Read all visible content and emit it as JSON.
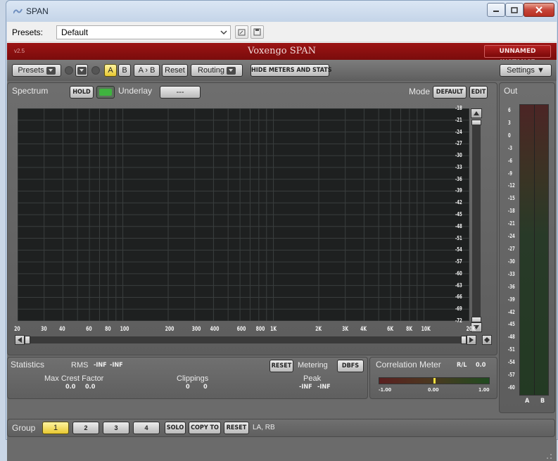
{
  "window": {
    "title": "SPAN"
  },
  "presetbar": {
    "label": "Presets:",
    "value": "Default"
  },
  "header": {
    "version": "v2.5",
    "title": "Voxengo SPAN",
    "instance": "UNNAMED INSTANCE"
  },
  "toolbar": {
    "presets": "Presets",
    "a": "A",
    "b": "B",
    "ab": "A › B",
    "reset": "Reset",
    "routing": "Routing",
    "hide_meters": "HIDE METERS AND STATS",
    "settings": "Settings ▼"
  },
  "spectrum": {
    "label": "Spectrum",
    "hold": "HOLD",
    "underlay_label": "Underlay",
    "underlay_value": "---",
    "mode_label": "Mode",
    "mode_value": "DEFAULT",
    "edit": "EDIT",
    "db_ticks": [
      "-18",
      "-21",
      "-24",
      "-27",
      "-30",
      "-33",
      "-36",
      "-39",
      "-42",
      "-45",
      "-48",
      "-51",
      "-54",
      "-57",
      "-60",
      "-63",
      "-66",
      "-69",
      "-72"
    ],
    "freq_ticks": [
      "20",
      "30",
      "40",
      "60",
      "80",
      "100",
      "200",
      "300",
      "400",
      "600",
      "800",
      "1K",
      "2K",
      "3K",
      "4K",
      "6K",
      "8K",
      "10K",
      "20K"
    ]
  },
  "out": {
    "label": "Out",
    "ticks": [
      "6",
      "3",
      "0",
      "-3",
      "-6",
      "-9",
      "-12",
      "-15",
      "-18",
      "-21",
      "-24",
      "-27",
      "-30",
      "-33",
      "-36",
      "-39",
      "-42",
      "-45",
      "-48",
      "-51",
      "-54",
      "-57",
      "-60"
    ],
    "left": "A",
    "right": "B"
  },
  "stats": {
    "label": "Statistics",
    "rms_label": "RMS",
    "rms_l": "-INF",
    "rms_r": "-INF",
    "reset": "RESET",
    "metering_label": "Metering",
    "metering_value": "DBFS",
    "crest_label": "Max Crest Factor",
    "crest_l": "0.0",
    "crest_r": "0.0",
    "clip_label": "Clippings",
    "clip_l": "0",
    "clip_r": "0",
    "peak_label": "Peak",
    "peak_l": "-INF",
    "peak_r": "-INF"
  },
  "correlation": {
    "label": "Correlation Meter",
    "rl_label": "R/L",
    "rl_value": "0.0",
    "scale": [
      "-1.00",
      "0.00",
      "1.00"
    ]
  },
  "group": {
    "label": "Group",
    "g1": "1",
    "g2": "2",
    "g3": "3",
    "g4": "4",
    "solo": "SOLO",
    "copy_to": "COPY TO",
    "reset": "RESET",
    "channels": "LA, RB"
  }
}
